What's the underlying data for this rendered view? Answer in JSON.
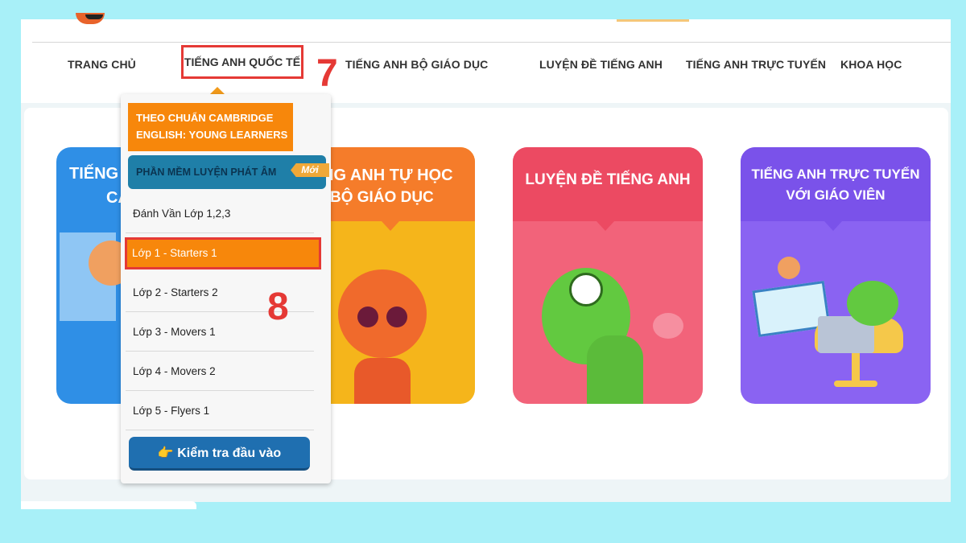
{
  "nav": {
    "home": "TRANG CHỦ",
    "intl": "TIẾNG ANH QUỐC TẾ",
    "moet": "TIẾNG ANH BỘ GIÁO DỤC",
    "exam": "LUYỆN ĐỀ TIẾNG ANH",
    "online": "TIẾNG ANH TRỰC TUYẾN",
    "courses": "KHOA HỌC"
  },
  "annotations": {
    "step7": "7",
    "step8": "8"
  },
  "cards": [
    {
      "line1": "TIẾNG",
      "line2": "CA"
    },
    {
      "line1": "NG ANH TỰ HỌC",
      "line2": "BỘ GIÁO DỤC"
    },
    {
      "line1": "LUYỆN ĐỀ TIẾNG ANH"
    },
    {
      "line1": "TIẾNG ANH TRỰC TUYẾN",
      "line2": "VỚI GIÁO VIÊN"
    }
  ],
  "dropdown": {
    "header_line1": "THEO CHUẨN CAMBRIDGE",
    "header_line2": "ENGLISH: YOUNG LEARNERS",
    "software": "PHẦN MỀM LUYỆN PHÁT ÂM",
    "new_badge": "Mới",
    "items": [
      "Đánh Vần Lớp 1,2,3",
      "Lớp 1 - Starters 1",
      "Lớp 2 - Starters 2",
      "Lớp 3 - Movers 1",
      "Lớp 4 - Movers 2",
      "Lớp 5 - Flyers 1"
    ],
    "check_icon": "👉",
    "check_label": "Kiểm tra đầu vào"
  },
  "colors": {
    "highlight": "#e53935",
    "orange": "#f7870b",
    "blue": "#1f7fa8",
    "card_blue": "#2f8fe6",
    "card_yellow": "#f5b51b",
    "card_pink": "#f2637a",
    "card_purple": "#8a63f2"
  }
}
